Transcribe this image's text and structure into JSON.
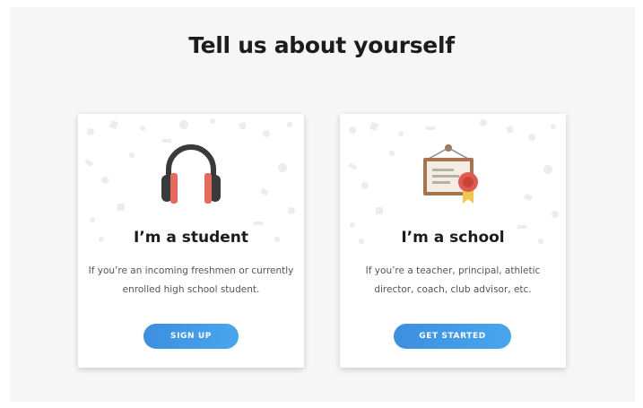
{
  "page": {
    "heading": "Tell us about yourself"
  },
  "cards": {
    "student": {
      "title": "I’m a student",
      "description": "If you’re an incoming freshmen or currently enrolled high school student.",
      "button_label": "SIGN UP",
      "icon": "headphones-icon"
    },
    "school": {
      "title": "I’m a school",
      "description": "If you’re a teacher, principal, athletic director, coach, club advisor, etc.",
      "button_label": "GET STARTED",
      "icon": "certificate-icon"
    }
  },
  "colors": {
    "panel_background": "#f6f6f6",
    "button_gradient_start": "#3c8fdf",
    "button_gradient_end": "#49a6ee",
    "heading_text": "#1c1c1c",
    "body_text": "#555555",
    "headphone_dark": "#3a3a3a",
    "headphone_accent": "#e8685a",
    "certificate_frame": "#a9744d",
    "certificate_seal": "#e05a4f",
    "certificate_ribbon": "#f2c84b"
  }
}
